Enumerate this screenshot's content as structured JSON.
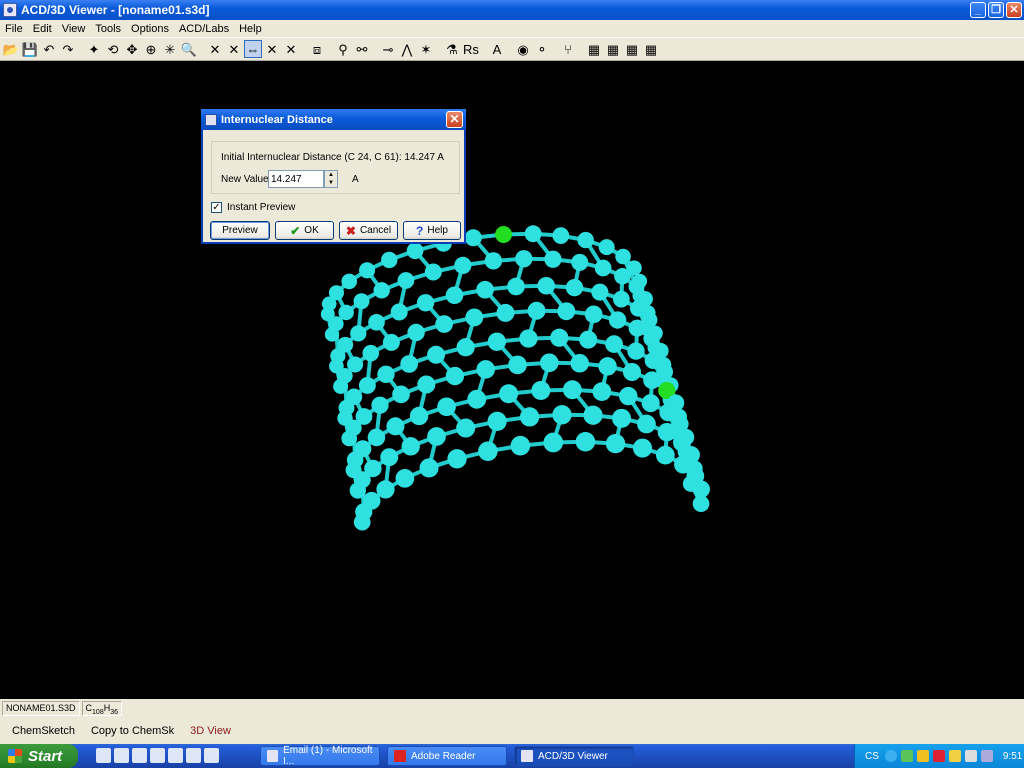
{
  "window": {
    "title": "ACD/3D Viewer - [noname01.s3d]",
    "min": "_",
    "restore": "❐",
    "close": "✕"
  },
  "menu": [
    "File",
    "Edit",
    "View",
    "Tools",
    "Options",
    "ACD/Labs",
    "Help"
  ],
  "toolbar": {
    "icons": [
      "open-icon",
      "save-icon",
      "undo-icon",
      "redo-icon",
      "sep",
      "select-icon",
      "rotate-icon",
      "move-icon",
      "zoom-icon",
      "atom-select-icon",
      "magnify-icon",
      "sep",
      "bond-icon",
      "bond-x-icon",
      "distance-icon",
      "angle-icon",
      "torsion-icon",
      "sep",
      "ring-icon",
      "sep",
      "link-icon",
      "chain-icon",
      "sep",
      "measure-icon",
      "bend-icon",
      "star-icon",
      "sep",
      "tube-icon",
      "rs-icon",
      "sep",
      "a-icon",
      "sep",
      "ball-stick-icon",
      "balls-icon",
      "sep",
      "tree-icon",
      "sep",
      "film-icon",
      "film2-icon",
      "film3-icon",
      "film4-icon"
    ],
    "glyphs": [
      "📂",
      "💾",
      "↶",
      "↷",
      "",
      "✦",
      "⟲",
      "✥",
      "⊕",
      "✳",
      "🔍",
      "",
      "✕",
      "✕",
      "⇔",
      "✕",
      "✕",
      "",
      "⧈",
      "",
      "⚲",
      "⚯",
      "",
      "⊸",
      "⋀",
      "✶",
      "",
      "⚗",
      "Rs",
      "",
      "A",
      "",
      "◉",
      "⚬",
      "",
      "⑂",
      "",
      "▦",
      "▦",
      "▦",
      "▦"
    ],
    "pressed_index": 14
  },
  "dialog": {
    "title": "Internuclear Distance",
    "close": "✕",
    "initial_label": "Initial Internuclear Distance (C 24, C 61): 14.247 A",
    "new_value_label": "New Value:",
    "new_value": "14.247",
    "unit": "A",
    "instant_preview_label": "Instant Preview",
    "instant_preview_checked": "✓",
    "buttons": {
      "preview": "Preview",
      "ok": "OK",
      "cancel": "Cancel",
      "help": "Help"
    },
    "button_icons": {
      "ok": "✔",
      "cancel": "✖",
      "help": "?"
    }
  },
  "status": {
    "file": "NONAME01.S3D",
    "formula_c": "C",
    "formula_c_sub": "108",
    "formula_h": "H",
    "formula_h_sub": "36"
  },
  "tabs": [
    "ChemSketch",
    "Copy to ChemSk",
    "3D View"
  ],
  "taskbar": {
    "start": "Start",
    "tasks": [
      "Email (1) - Microsoft I...",
      "Adobe Reader",
      "ACD/3D Viewer"
    ],
    "lang": "CS",
    "time": "9:51"
  },
  "colors": {
    "atom": "#2ee0e0",
    "bond": "#22cccc",
    "highlight": "#22dd22",
    "background": "#000000"
  }
}
